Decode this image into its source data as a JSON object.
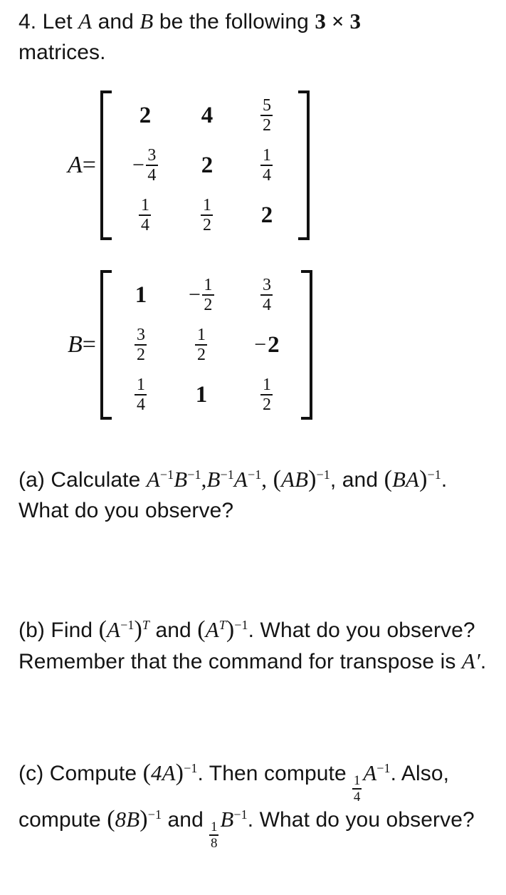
{
  "document": {
    "problem_number": "4.",
    "heading": {
      "text_before": "Let",
      "var_a": "A",
      "and": "and",
      "var_b": "B",
      "text_after": "be the following",
      "dims": "3 × 3",
      "line2": "matrices."
    }
  },
  "matrix_a": {
    "name": "A",
    "equals": "=",
    "rows": [
      [
        {
          "type": "int",
          "value": "2"
        },
        {
          "type": "int",
          "value": "4"
        },
        {
          "type": "frac",
          "num": "5",
          "den": "2"
        }
      ],
      [
        {
          "type": "frac",
          "sign": "−",
          "num": "3",
          "den": "4"
        },
        {
          "type": "int",
          "value": "2"
        },
        {
          "type": "frac",
          "num": "1",
          "den": "4"
        }
      ],
      [
        {
          "type": "frac",
          "num": "1",
          "den": "4"
        },
        {
          "type": "frac",
          "num": "1",
          "den": "2"
        },
        {
          "type": "int",
          "value": "2"
        }
      ]
    ]
  },
  "matrix_b": {
    "name": "B",
    "equals": "=",
    "rows": [
      [
        {
          "type": "int",
          "value": "1"
        },
        {
          "type": "frac",
          "sign": "−",
          "num": "1",
          "den": "2"
        },
        {
          "type": "frac",
          "num": "3",
          "den": "4"
        }
      ],
      [
        {
          "type": "frac",
          "num": "3",
          "den": "2"
        },
        {
          "type": "frac",
          "num": "1",
          "den": "2"
        },
        {
          "type": "int",
          "sign": "−",
          "value": "2"
        }
      ],
      [
        {
          "type": "frac",
          "num": "1",
          "den": "4"
        },
        {
          "type": "int",
          "value": "1"
        },
        {
          "type": "frac",
          "num": "1",
          "den": "2"
        }
      ]
    ]
  },
  "parts": {
    "a": {
      "label": "(a)",
      "verb": "Calculate",
      "expr1_base1": "A",
      "expr1_sup1": "−1",
      "expr1_base2": "B",
      "expr1_sup2": "−1",
      "comma1": ",",
      "expr2_base1": "B",
      "expr2_sup1": "−1",
      "expr2_base2": "A",
      "expr2_sup2": "−1",
      "comma2": ",",
      "expr3_open": "(",
      "expr3_inner": "AB",
      "expr3_close": ")",
      "expr3_sup": "−1",
      "and_text": ", and",
      "expr4_open": "(",
      "expr4_inner": "BA",
      "expr4_close": ")",
      "expr4_sup": "−1",
      "tail": ". What do you observe?"
    },
    "b": {
      "label": "(b)",
      "verb": "Find",
      "expr1_open": "(",
      "expr1_base": "A",
      "expr1_inner_sup": "−1",
      "expr1_close": ")",
      "expr1_sup": "T",
      "and_text": "and",
      "expr2_open": "(",
      "expr2_base": "A",
      "expr2_inner_sup": "T",
      "expr2_close": ")",
      "expr2_sup": "−1",
      "tail": ". What do you observe? Remember that the command for transpose is",
      "transpose_cmd": "A′",
      "tail2": "."
    },
    "c": {
      "label": "(c)",
      "verb": "Compute",
      "expr1_open": "(",
      "expr1_inner": "4A",
      "expr1_close": ")",
      "expr1_sup": "−1",
      "mid1": ". Then compute",
      "expr2_frac_num": "1",
      "expr2_frac_den": "4",
      "expr2_base": "A",
      "expr2_sup": "−1",
      "mid2": ". Also, compute",
      "expr3_open": "(",
      "expr3_inner": "8B",
      "expr3_close": ")",
      "expr3_sup": "−1",
      "mid3": "and",
      "expr4_frac_num": "1",
      "expr4_frac_den": "8",
      "expr4_base": "B",
      "expr4_sup": "−1",
      "tail": ". What do you observe?"
    }
  },
  "colors": {
    "background": "#ffffff",
    "text": "#141414",
    "rule": "#111111"
  }
}
